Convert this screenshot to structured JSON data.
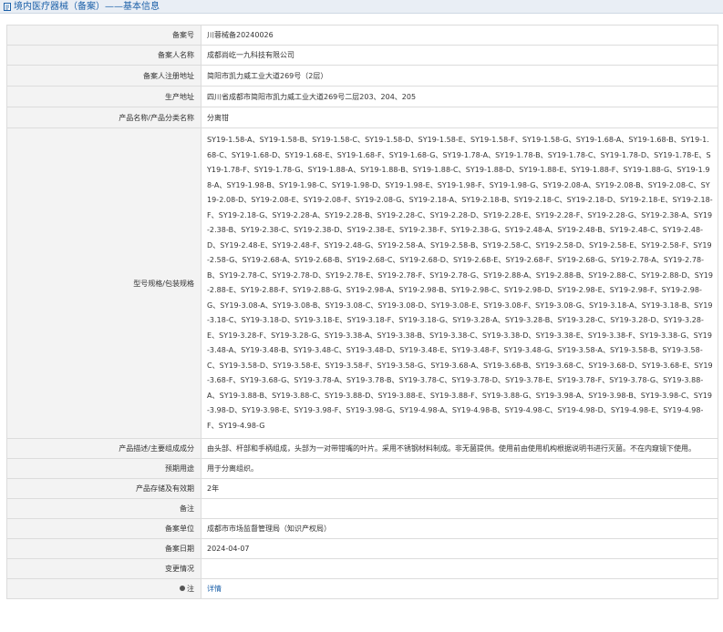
{
  "header": {
    "title": "境内医疗器械（备案）——基本信息",
    "icon": "document-icon"
  },
  "rows": [
    {
      "label": "备案号",
      "value": "川蓉械备20240026"
    },
    {
      "label": "备案人名称",
      "value": "成都尚屹一九科技有限公司"
    },
    {
      "label": "备案人注册地址",
      "value": "简阳市凯力威工业大道269号（2层）"
    },
    {
      "label": "生产地址",
      "value": "四川省成都市简阳市凯力威工业大道269号二层203、204、205"
    },
    {
      "label": "产品名称/产品分类名称",
      "value": "分离钳"
    },
    {
      "label": "型号规格/包装规格",
      "value": "SY19-1.58-A、SY19-1.58-B、SY19-1.58-C、SY19-1.58-D、SY19-1.58-E、SY19-1.58-F、SY19-1.58-G、SY19-1.68-A、SY19-1.68-B、SY19-1.68-C、SY19-1.68-D、SY19-1.68-E、SY19-1.68-F、SY19-1.68-G、SY19-1.78-A、SY19-1.78-B、SY19-1.78-C、SY19-1.78-D、SY19-1.78-E、SY19-1.78-F、SY19-1.78-G、SY19-1.88-A、SY19-1.88-B、SY19-1.88-C、SY19-1.88-D、SY19-1.88-E、SY19-1.88-F、SY19-1.88-G、SY19-1.98-A、SY19-1.98-B、SY19-1.98-C、SY19-1.98-D、SY19-1.98-E、SY19-1.98-F、SY19-1.98-G、SY19-2.08-A、SY19-2.08-B、SY19-2.08-C、SY19-2.08-D、SY19-2.08-E、SY19-2.08-F、SY19-2.08-G、SY19-2.18-A、SY19-2.18-B、SY19-2.18-C、SY19-2.18-D、SY19-2.18-E、SY19-2.18-F、SY19-2.18-G、SY19-2.28-A、SY19-2.28-B、SY19-2.28-C、SY19-2.28-D、SY19-2.28-E、SY19-2.28-F、SY19-2.28-G、SY19-2.38-A、SY19-2.38-B、SY19-2.38-C、SY19-2.38-D、SY19-2.38-E、SY19-2.38-F、SY19-2.38-G、SY19-2.48-A、SY19-2.48-B、SY19-2.48-C、SY19-2.48-D、SY19-2.48-E、SY19-2.48-F、SY19-2.48-G、SY19-2.58-A、SY19-2.58-B、SY19-2.58-C、SY19-2.58-D、SY19-2.58-E、SY19-2.58-F、SY19-2.58-G、SY19-2.68-A、SY19-2.68-B、SY19-2.68-C、SY19-2.68-D、SY19-2.68-E、SY19-2.68-F、SY19-2.68-G、SY19-2.78-A、SY19-2.78-B、SY19-2.78-C、SY19-2.78-D、SY19-2.78-E、SY19-2.78-F、SY19-2.78-G、SY19-2.88-A、SY19-2.88-B、SY19-2.88-C、SY19-2.88-D、SY19-2.88-E、SY19-2.88-F、SY19-2.88-G、SY19-2.98-A、SY19-2.98-B、SY19-2.98-C、SY19-2.98-D、SY19-2.98-E、SY19-2.98-F、SY19-2.98-G、SY19-3.08-A、SY19-3.08-B、SY19-3.08-C、SY19-3.08-D、SY19-3.08-E、SY19-3.08-F、SY19-3.08-G、SY19-3.18-A、SY19-3.18-B、SY19-3.18-C、SY19-3.18-D、SY19-3.18-E、SY19-3.18-F、SY19-3.18-G、SY19-3.28-A、SY19-3.28-B、SY19-3.28-C、SY19-3.28-D、SY19-3.28-E、SY19-3.28-F、SY19-3.28-G、SY19-3.38-A、SY19-3.38-B、SY19-3.38-C、SY19-3.38-D、SY19-3.38-E、SY19-3.38-F、SY19-3.38-G、SY19-3.48-A、SY19-3.48-B、SY19-3.48-C、SY19-3.48-D、SY19-3.48-E、SY19-3.48-F、SY19-3.48-G、SY19-3.58-A、SY19-3.58-B、SY19-3.58-C、SY19-3.58-D、SY19-3.58-E、SY19-3.58-F、SY19-3.58-G、SY19-3.68-A、SY19-3.68-B、SY19-3.68-C、SY19-3.68-D、SY19-3.68-E、SY19-3.68-F、SY19-3.68-G、SY19-3.78-A、SY19-3.78-B、SY19-3.78-C、SY19-3.78-D、SY19-3.78-E、SY19-3.78-F、SY19-3.78-G、SY19-3.88-A、SY19-3.88-B、SY19-3.88-C、SY19-3.88-D、SY19-3.88-E、SY19-3.88-F、SY19-3.88-G、SY19-3.98-A、SY19-3.98-B、SY19-3.98-C、SY19-3.98-D、SY19-3.98-E、SY19-3.98-F、SY19-3.98-G、SY19-4.98-A、SY19-4.98-B、SY19-4.98-C、SY19-4.98-D、SY19-4.98-E、SY19-4.98-F、SY19-4.98-G"
    },
    {
      "label": "产品描述/主要组成成分",
      "value": "由头部、杆部和手柄组成，头部为一对带钳嘴的叶片。采用不锈钢材料制成。非无菌提供。使用前由使用机构根据说明书进行灭菌。不在内窥镜下使用。"
    },
    {
      "label": "预期用途",
      "value": "用于分离组织。"
    },
    {
      "label": "产品存储及有效期",
      "value": "2年"
    },
    {
      "label": "备注",
      "value": ""
    },
    {
      "label": "备案单位",
      "value": "成都市市场监督管理局（知识产权局）"
    },
    {
      "label": "备案日期",
      "value": "2024-04-07"
    },
    {
      "label": "变更情况",
      "value": ""
    }
  ],
  "note_row": {
    "label": "注",
    "link_text": "详情",
    "icon": "bullet-icon"
  }
}
